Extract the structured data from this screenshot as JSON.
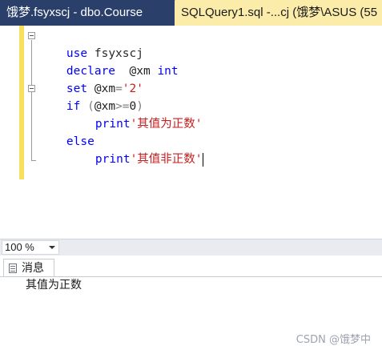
{
  "tabs": {
    "inactive_title": "饿梦.fsyxscj - dbo.Course",
    "active_title": "SQLQuery1.sql -...cj (饿梦\\ASUS (55"
  },
  "code": {
    "line1": {
      "kw": "use",
      "ident": " fsyxscj"
    },
    "line2": {
      "kw": "declare",
      "gap": "  ",
      "var": "@xm",
      "kw2": "int"
    },
    "line3": {
      "kw": "set",
      "var": "@xm",
      "op": "=",
      "str": "'2'"
    },
    "line4": {
      "kw": "if",
      "open": "(",
      "var": "@xm",
      "op": ">=",
      "num": "0",
      "close": ")"
    },
    "line5": {
      "kw": "print",
      "str": "'其值为正数'"
    },
    "line6": {
      "kw": "else"
    },
    "line7": {
      "kw": "print",
      "str": "'其值非正数'"
    }
  },
  "zoom": {
    "value": "100 %"
  },
  "results": {
    "tab_label": "消息",
    "message": "其值为正数"
  },
  "watermark": "CSDN @饿梦中",
  "colors": {
    "tab_strip": "#2b3f6b",
    "active_tab": "#fcecaa",
    "change_bar": "#f6e05e",
    "keyword": "#0000ff",
    "string": "#c81e1e"
  }
}
